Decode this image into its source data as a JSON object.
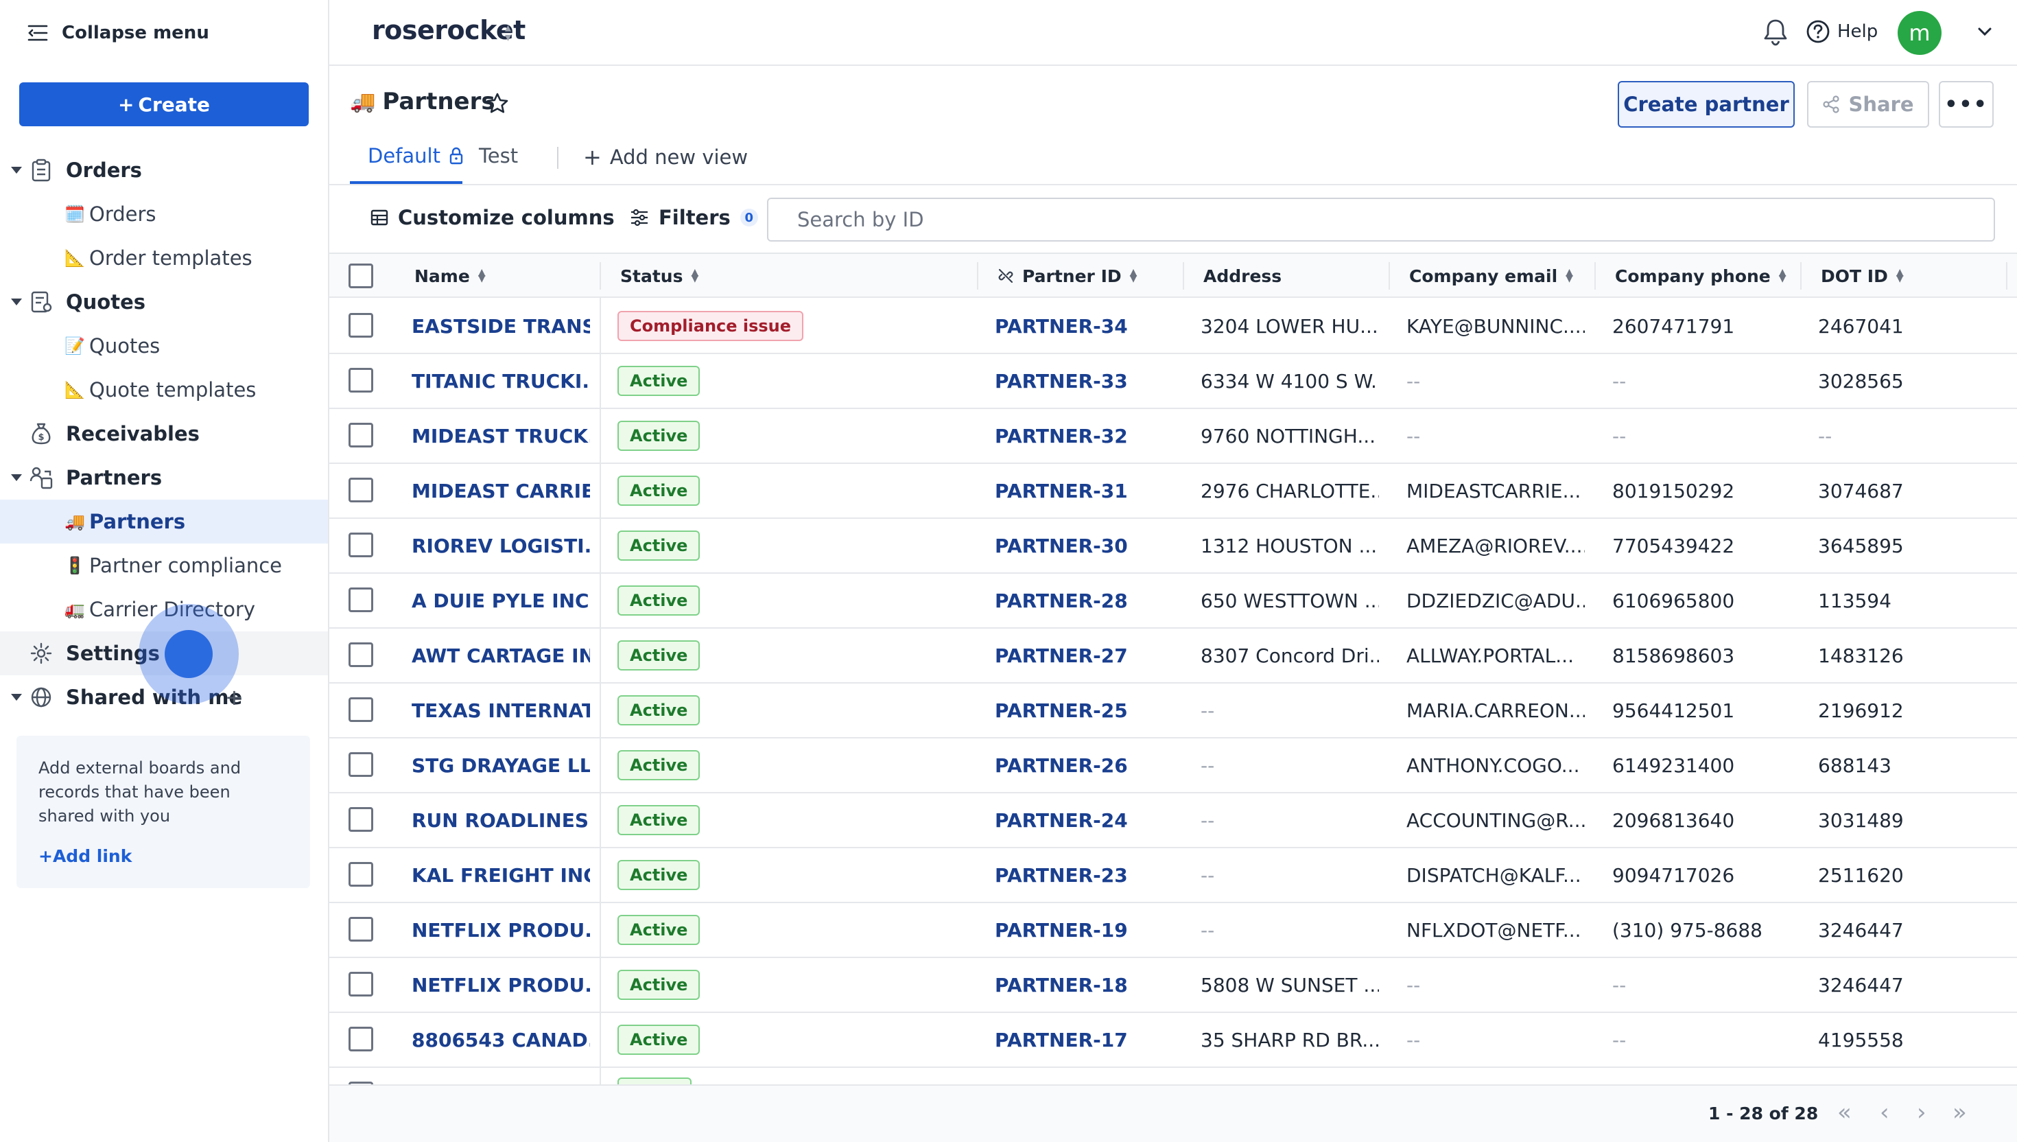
{
  "sidebar": {
    "collapse_label": "Collapse menu",
    "create_label": "Create",
    "items": [
      {
        "label": "Orders"
      },
      {
        "label": "Orders",
        "emoji": "🗓️"
      },
      {
        "label": "Order templates",
        "emoji": "📐"
      },
      {
        "label": "Quotes"
      },
      {
        "label": "Quotes",
        "emoji": "📝"
      },
      {
        "label": "Quote templates",
        "emoji": "📐"
      },
      {
        "label": "Receivables"
      },
      {
        "label": "Partners"
      },
      {
        "label": "Partners",
        "emoji": "🚚"
      },
      {
        "label": "Partner compliance",
        "emoji": "🚦"
      },
      {
        "label": "Carrier Directory",
        "emoji": "🚛"
      },
      {
        "label": "Settings"
      },
      {
        "label": "Shared with me"
      }
    ],
    "external": {
      "text": "Add external boards and records that have been shared with you",
      "link": "Add link"
    }
  },
  "topbar": {
    "logo": "roserocket",
    "help": "Help",
    "avatar_initial": "m"
  },
  "page": {
    "emoji": "🚚",
    "title": "Partners",
    "create_partner": "Create partner",
    "share": "Share",
    "tabs": [
      {
        "label": "Default"
      },
      {
        "label": "Test"
      },
      {
        "label": "Add new view"
      }
    ]
  },
  "toolbar": {
    "customize": "Customize columns",
    "filters": "Filters",
    "filter_count": "0",
    "search_placeholder": "Search by ID"
  },
  "table": {
    "columns": [
      "Name",
      "Status",
      "Partner ID",
      "Address",
      "Company email",
      "Company phone",
      "DOT ID"
    ],
    "rows": [
      {
        "name": "EASTSIDE TRANS...",
        "status": "Compliance issue",
        "pid": "PARTNER-34",
        "address": "3204 LOWER HU...",
        "email": "KAYE@BUNNINC....",
        "phone": "2607471791",
        "dot": "2467041"
      },
      {
        "name": "TITANIC TRUCKI...",
        "status": "Active",
        "pid": "PARTNER-33",
        "address": "6334 W 4100 S W...",
        "email": "--",
        "phone": "--",
        "dot": "3028565"
      },
      {
        "name": "MIDEAST TRUCK...",
        "status": "Active",
        "pid": "PARTNER-32",
        "address": "9760 NOTTINGH...",
        "email": "--",
        "phone": "--",
        "dot": "--"
      },
      {
        "name": "MIDEAST CARRIE...",
        "status": "Active",
        "pid": "PARTNER-31",
        "address": "2976 CHARLOTTE...",
        "email": "MIDEASTCARRIE...",
        "phone": "8019150292",
        "dot": "3074687"
      },
      {
        "name": "RIOREV LOGISTI...",
        "status": "Active",
        "pid": "PARTNER-30",
        "address": "1312 HOUSTON ...",
        "email": "AMEZA@RIOREV....",
        "phone": "7705439422",
        "dot": "3645895"
      },
      {
        "name": "A DUIE PYLE INC",
        "status": "Active",
        "pid": "PARTNER-28",
        "address": "650 WESTTOWN ...",
        "email": "DDZIEDZIC@ADU...",
        "phone": "6106965800",
        "dot": "113594"
      },
      {
        "name": "AWT CARTAGE INC",
        "status": "Active",
        "pid": "PARTNER-27",
        "address": "8307 Concord Dri...",
        "email": "ALLWAY.PORTAL...",
        "phone": "8158698603",
        "dot": "1483126"
      },
      {
        "name": "TEXAS INTERNAT...",
        "status": "Active",
        "pid": "PARTNER-25",
        "address": "--",
        "email": "MARIA.CARREON...",
        "phone": "9564412501",
        "dot": "2196912"
      },
      {
        "name": "STG DRAYAGE LLC",
        "status": "Active",
        "pid": "PARTNER-26",
        "address": "--",
        "email": "ANTHONY.COGO...",
        "phone": "6149231400",
        "dot": "688143"
      },
      {
        "name": "RUN ROADLINES...",
        "status": "Active",
        "pid": "PARTNER-24",
        "address": "--",
        "email": "ACCOUNTING@R...",
        "phone": "2096813640",
        "dot": "3031489"
      },
      {
        "name": "KAL FREIGHT INC",
        "status": "Active",
        "pid": "PARTNER-23",
        "address": "--",
        "email": "DISPATCH@KALF...",
        "phone": "9094717026",
        "dot": "2511620"
      },
      {
        "name": "NETFLIX PRODU...",
        "status": "Active",
        "pid": "PARTNER-19",
        "address": "--",
        "email": "NFLXDOT@NETF...",
        "phone": "(310) 975-8688",
        "dot": "3246447"
      },
      {
        "name": "NETFLIX PRODU...",
        "status": "Active",
        "pid": "PARTNER-18",
        "address": "5808 W SUNSET ...",
        "email": "--",
        "phone": "--",
        "dot": "3246447"
      },
      {
        "name": "8806543 CANAD...",
        "status": "Active",
        "pid": "PARTNER-17",
        "address": "35 SHARP RD BR...",
        "email": "--",
        "phone": "--",
        "dot": "4195558"
      }
    ]
  },
  "pager": {
    "range": "1 - 28 of 28"
  },
  "colors": {
    "primary": "#1d5fd6",
    "link": "#1a3f8f",
    "active_bg": "#ecfbe9",
    "issue_bg": "#fdecef",
    "avatar": "#27a745"
  }
}
